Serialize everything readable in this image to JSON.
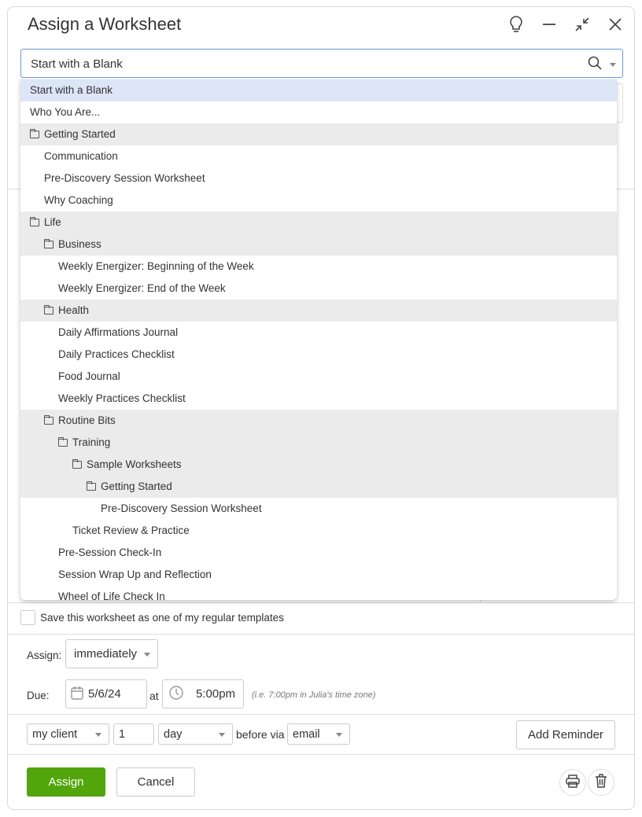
{
  "dialog": {
    "title": "Assign a Worksheet"
  },
  "header_icons": [
    "lightbulb-icon",
    "minimize-icon",
    "collapse-icon",
    "close-icon"
  ],
  "worksheet_select": {
    "value": "Start with a Blank"
  },
  "dropdown_items": [
    {
      "label": "Start with a Blank",
      "level": 0,
      "folder": false,
      "selected": true
    },
    {
      "label": "Who You Are...",
      "level": 0,
      "folder": false
    },
    {
      "label": "Getting Started",
      "level": 0,
      "folder": true
    },
    {
      "label": "Communication",
      "level": 1,
      "folder": false
    },
    {
      "label": "Pre-Discovery Session Worksheet",
      "level": 1,
      "folder": false
    },
    {
      "label": "Why Coaching",
      "level": 1,
      "folder": false
    },
    {
      "label": "Life",
      "level": 0,
      "folder": true
    },
    {
      "label": "Business",
      "level": 1,
      "folder": true
    },
    {
      "label": "Weekly Energizer: Beginning of the Week",
      "level": 2,
      "folder": false
    },
    {
      "label": "Weekly Energizer: End of the Week",
      "level": 2,
      "folder": false
    },
    {
      "label": "Health",
      "level": 1,
      "folder": true
    },
    {
      "label": "Daily Affirmations Journal",
      "level": 2,
      "folder": false
    },
    {
      "label": "Daily Practices Checklist",
      "level": 2,
      "folder": false
    },
    {
      "label": "Food Journal",
      "level": 2,
      "folder": false
    },
    {
      "label": "Weekly Practices Checklist",
      "level": 2,
      "folder": false
    },
    {
      "label": "Routine Bits",
      "level": 1,
      "folder": true
    },
    {
      "label": "Training",
      "level": 2,
      "folder": true
    },
    {
      "label": "Sample Worksheets",
      "level": 3,
      "folder": true
    },
    {
      "label": "Getting Started",
      "level": 4,
      "folder": true
    },
    {
      "label": "Pre-Discovery Session Worksheet",
      "level": 5,
      "folder": false
    },
    {
      "label": "Ticket Review & Practice",
      "level": 3,
      "folder": false
    },
    {
      "label": "Pre-Session Check-In",
      "level": 2,
      "folder": false
    },
    {
      "label": "Session Wrap Up and Reflection",
      "level": 2,
      "folder": false
    },
    {
      "label": "Wheel of Life Check In",
      "level": 2,
      "folder": false
    }
  ],
  "save_template": {
    "label": "Save this worksheet as one of my regular templates",
    "checked": false
  },
  "assign": {
    "label": "Assign:",
    "value": "immediately"
  },
  "due": {
    "label": "Due:",
    "date": "5/6/24",
    "at": "at",
    "time": "5:00pm",
    "hint": "(i.e. 7:00pm in Julia's time zone)"
  },
  "reminder": {
    "recipient": "my client",
    "amount": "1",
    "unit": "day",
    "before_via": "before via",
    "channel": "email",
    "add_label": "Add Reminder"
  },
  "footer": {
    "assign_label": "Assign",
    "cancel_label": "Cancel"
  },
  "colors": {
    "primary": "#52a50a",
    "selected": "#dce6f7",
    "folder_row": "#ebebeb",
    "focus": "#6a9ad6"
  }
}
